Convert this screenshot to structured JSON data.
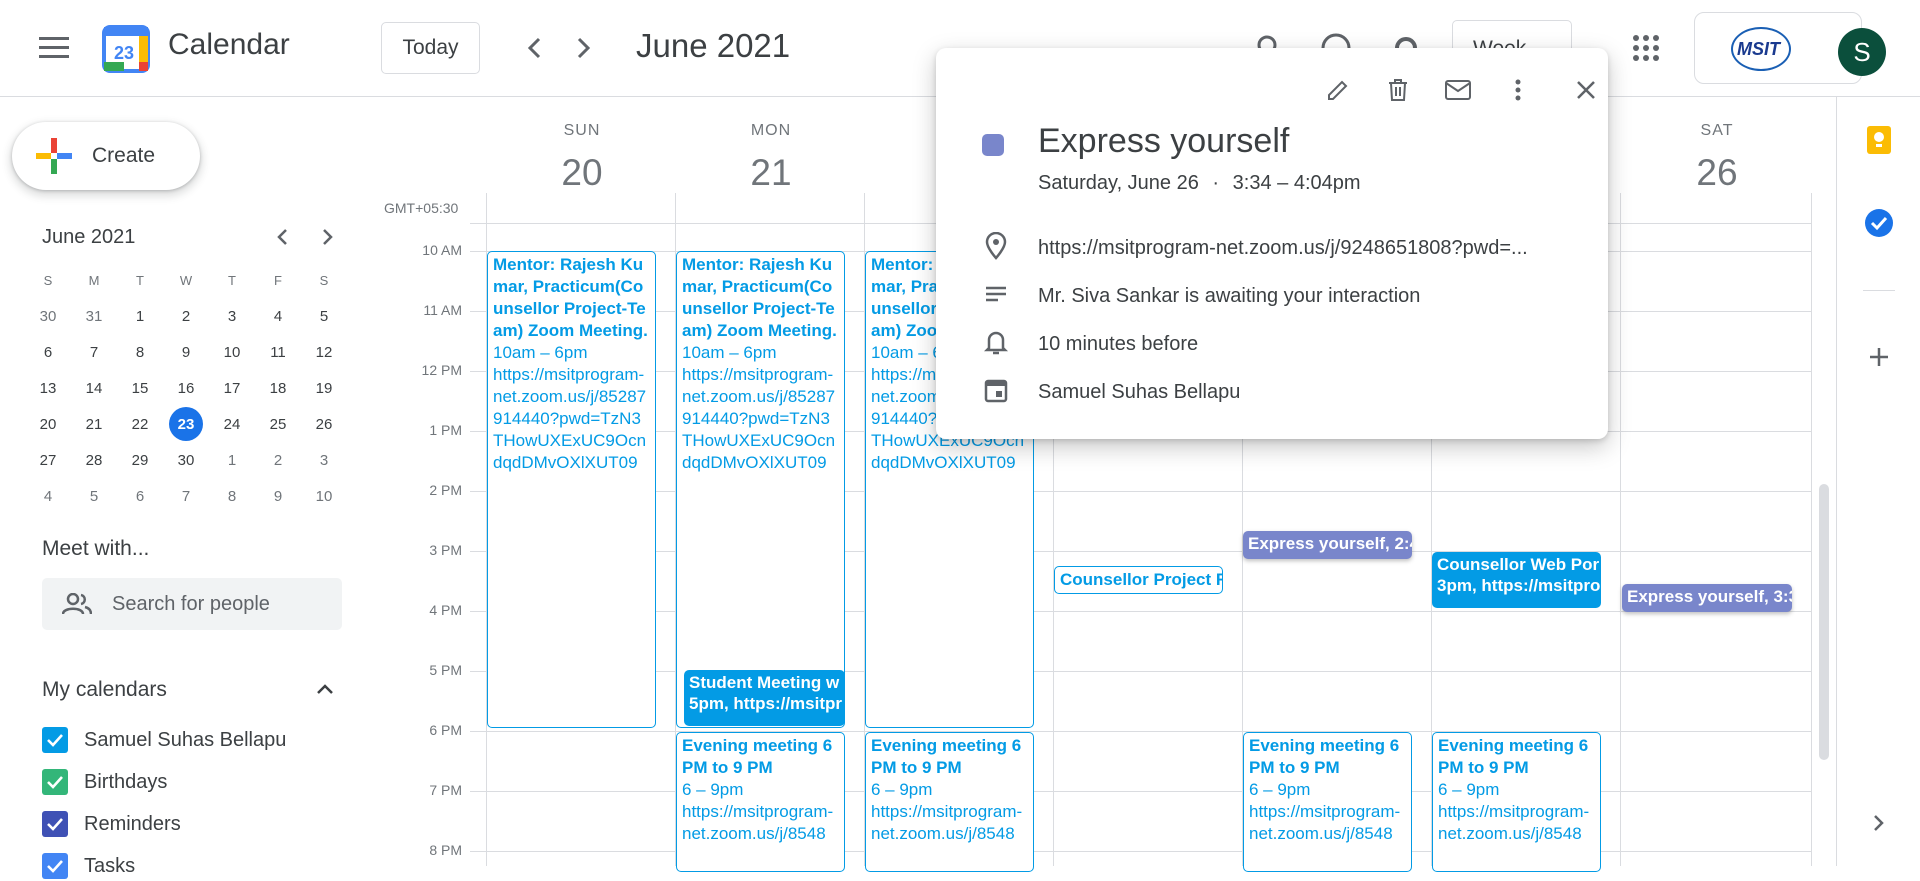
{
  "header": {
    "app_title": "Calendar",
    "calendar_logo_day": "23",
    "today_label": "Today",
    "month_title": "June 2021",
    "view_label": "Week",
    "org_logo_text": "MSIT",
    "avatar_letter": "S"
  },
  "sidebar": {
    "create_label": "Create",
    "mini_month": "June 2021",
    "weekday_heads": [
      "S",
      "M",
      "T",
      "W",
      "T",
      "F",
      "S"
    ],
    "weeks": [
      [
        "30",
        "31",
        "1",
        "2",
        "3",
        "4",
        "5"
      ],
      [
        "6",
        "7",
        "8",
        "9",
        "10",
        "11",
        "12"
      ],
      [
        "13",
        "14",
        "15",
        "16",
        "17",
        "18",
        "19"
      ],
      [
        "20",
        "21",
        "22",
        "23",
        "24",
        "25",
        "26"
      ],
      [
        "27",
        "28",
        "29",
        "30",
        "1",
        "2",
        "3"
      ],
      [
        "4",
        "5",
        "6",
        "7",
        "8",
        "9",
        "10"
      ]
    ],
    "today_date": "23",
    "meet_title": "Meet with...",
    "search_placeholder": "Search for people",
    "my_calendars_title": "My calendars",
    "calendars": [
      {
        "label": "Samuel Suhas Bellapu",
        "color": "#039be5"
      },
      {
        "label": "Birthdays",
        "color": "#33b679"
      },
      {
        "label": "Reminders",
        "color": "#3f51b5"
      },
      {
        "label": "Tasks",
        "color": "#4285f4"
      }
    ]
  },
  "grid": {
    "timezone": "GMT+05:30",
    "days": [
      {
        "name": "SUN",
        "num": "20"
      },
      {
        "name": "MON",
        "num": "21"
      },
      {
        "name": "SAT",
        "num": "26"
      }
    ],
    "hours": [
      "10 AM",
      "11 AM",
      "12 PM",
      "1 PM",
      "2 PM",
      "3 PM",
      "4 PM",
      "5 PM",
      "6 PM",
      "7 PM",
      "8 PM"
    ]
  },
  "events": {
    "mentor_title": "Mentor: Rajesh Kumar, Practicum(Counsellor Project-Team) Zoom Meeting.",
    "mentor_time": "10am – 6pm",
    "mentor_link": "https://msitprogram-net.zoom.us/j/85287914440?pwd=TzN3THowUXExUC9OcndqdDMvOXlXUT09",
    "student_title": "Student Meeting w",
    "student_time": "5pm, https://msitpr",
    "evening_title": "Evening meeting 6 PM to 9 PM",
    "evening_time": "6 – 9pm",
    "evening_link": "https://msitprogram-net.zoom.us/j/8548",
    "counsellor_project": "Counsellor Project R",
    "express_wed": "Express yourself, 2:4",
    "counsellor_web_title": "Counsellor Web Por",
    "counsellor_web_time": "3pm, https://msitpro",
    "express_sat": "Express yourself, 3:3"
  },
  "popup": {
    "title": "Express yourself",
    "date": "Saturday, June 26",
    "time": "3:34 – 4:04pm",
    "location": "https://msitprogram-net.zoom.us/j/9248651808?pwd=...",
    "description": "Mr. Siva Sankar is awaiting your interaction",
    "reminder": "10 minutes before",
    "calendar": "Samuel Suhas Bellapu",
    "color": "#7986cb"
  },
  "colors": {
    "event_blue": "#039be5",
    "event_purple": "#7986cb",
    "today_blue": "#1a73e8"
  }
}
